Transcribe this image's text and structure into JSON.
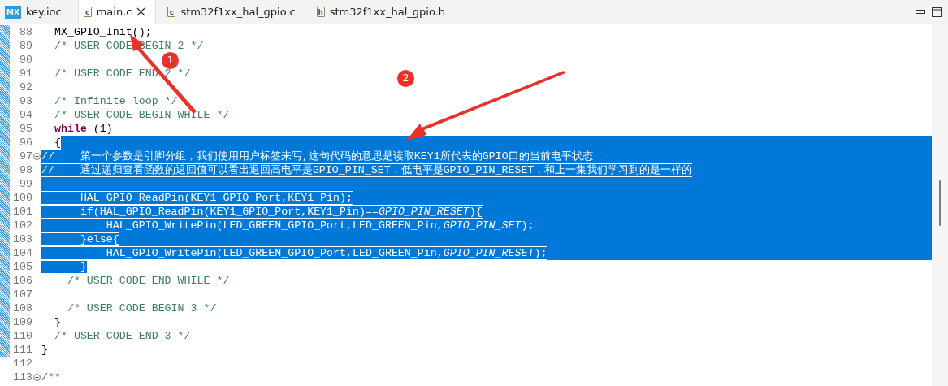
{
  "tabs": [
    {
      "label": "key.ioc",
      "kind": "mx",
      "icon_text": "MX",
      "selected": false
    },
    {
      "label": "main.c",
      "kind": "file",
      "icon_text": "c",
      "selected": true
    },
    {
      "label": "stm32f1xx_hal_gpio.c",
      "kind": "file",
      "icon_text": "c",
      "selected": false
    },
    {
      "label": "stm32f1xx_hal_gpio.h",
      "kind": "file",
      "icon_text": "h",
      "selected": false
    }
  ],
  "lines": [
    {
      "number": "88",
      "marked": true,
      "fold": false,
      "selected": false,
      "segments": [
        {
          "kind": "code",
          "text": "  MX_GPIO_Init();",
          "selected": false
        }
      ]
    },
    {
      "number": "89",
      "marked": true,
      "fold": false,
      "selected": false,
      "segments": [
        {
          "kind": "comment",
          "text": "  /* USER CODE BEGIN 2 */",
          "selected": false
        }
      ]
    },
    {
      "number": "90",
      "marked": true,
      "fold": false,
      "selected": false
    },
    {
      "number": "91",
      "marked": true,
      "fold": false,
      "selected": false,
      "segments": [
        {
          "kind": "comment",
          "text": "  /* USER CODE END 2 */",
          "selected": false
        }
      ]
    },
    {
      "number": "92",
      "marked": true,
      "fold": false,
      "selected": false
    },
    {
      "number": "93",
      "marked": true,
      "fold": false,
      "selected": false,
      "segments": [
        {
          "kind": "comment",
          "text": "  /* Infinite loop */",
          "selected": false
        }
      ]
    },
    {
      "number": "94",
      "marked": true,
      "fold": false,
      "selected": false,
      "segments": [
        {
          "kind": "comment",
          "text": "  /* USER CODE BEGIN WHILE */",
          "selected": false
        }
      ]
    },
    {
      "number": "95",
      "marked": true,
      "fold": false,
      "selected": false,
      "segments": [
        {
          "kind": "keyword",
          "text": "  while",
          "selected": false
        },
        {
          "kind": "code",
          "text": " (1)",
          "selected": false
        }
      ]
    },
    {
      "number": "96",
      "marked": true,
      "fold": false,
      "selected": true,
      "segments": [
        {
          "kind": "code",
          "text": "  {",
          "selected": false
        }
      ]
    },
    {
      "number": "97",
      "marked": true,
      "fold": true,
      "selected": true,
      "segments": [
        {
          "kind": "comment",
          "text": "//    第一个参数是引脚分组，我们使用用户标签来写,这句代码的意思是读取KEY1所代表的GPIO口的当前电平状态",
          "selected": true
        }
      ]
    },
    {
      "number": "98",
      "marked": true,
      "fold": false,
      "selected": true,
      "segments": [
        {
          "kind": "comment",
          "text": "//    通过递归查看函数的返回值可以看出返回高电平是GPIO_PIN_SET，低电平是GPIO_PIN_RESET，和上一集我们学习到的是一样的",
          "selected": true
        }
      ]
    },
    {
      "number": "99",
      "marked": true,
      "fold": false,
      "selected": true
    },
    {
      "number": "100",
      "marked": true,
      "fold": false,
      "selected": true,
      "segments": [
        {
          "kind": "code",
          "text": "      HAL_GPIO_ReadPin(KEY1_GPIO_Port,KEY1_Pin);",
          "selected": true
        }
      ]
    },
    {
      "number": "101",
      "marked": true,
      "fold": false,
      "selected": true,
      "segments": [
        {
          "kind": "code",
          "text": "      if(HAL_GPIO_ReadPin(KEY1_GPIO_Port,KEY1_Pin)==",
          "selected": true
        },
        {
          "kind": "constant",
          "text": "GPIO_PIN_RESET",
          "selected": true
        },
        {
          "kind": "code",
          "text": "){",
          "selected": true
        }
      ]
    },
    {
      "number": "102",
      "marked": true,
      "fold": false,
      "selected": true,
      "segments": [
        {
          "kind": "code",
          "text": "          HAL_GPIO_WritePin(LED_GREEN_GPIO_Port,LED_GREEN_Pin,",
          "selected": true
        },
        {
          "kind": "constant",
          "text": "GPIO_PIN_SET",
          "selected": true
        },
        {
          "kind": "code",
          "text": ");",
          "selected": true
        }
      ]
    },
    {
      "number": "103",
      "marked": true,
      "fold": false,
      "selected": true,
      "segments": [
        {
          "kind": "code",
          "text": "      }else{",
          "selected": true
        }
      ]
    },
    {
      "number": "104",
      "marked": true,
      "fold": false,
      "selected": true,
      "segments": [
        {
          "kind": "code",
          "text": "          HAL_GPIO_WritePin(LED_GREEN_GPIO_Port,LED_GREEN_Pin,",
          "selected": true
        },
        {
          "kind": "constant",
          "text": "GPIO_PIN_RESET",
          "selected": true
        },
        {
          "kind": "code",
          "text": ");",
          "selected": true
        }
      ]
    },
    {
      "number": "105",
      "marked": true,
      "fold": false,
      "selected": false,
      "segments": [
        {
          "kind": "code",
          "text": "      }",
          "selected": true
        }
      ]
    },
    {
      "number": "106",
      "marked": true,
      "fold": false,
      "selected": false,
      "segments": [
        {
          "kind": "comment",
          "text": "    /* USER CODE END WHILE */",
          "selected": false
        }
      ]
    },
    {
      "number": "107",
      "marked": true,
      "fold": false,
      "selected": false
    },
    {
      "number": "108",
      "marked": true,
      "fold": false,
      "selected": false,
      "segments": [
        {
          "kind": "comment",
          "text": "    /* USER CODE BEGIN 3 */",
          "selected": false
        }
      ]
    },
    {
      "number": "109",
      "marked": true,
      "fold": false,
      "selected": false,
      "segments": [
        {
          "kind": "code",
          "text": "  }",
          "selected": false
        }
      ]
    },
    {
      "number": "110",
      "marked": true,
      "fold": false,
      "selected": false,
      "segments": [
        {
          "kind": "comment",
          "text": "  /* USER CODE END 3 */",
          "selected": false
        }
      ]
    },
    {
      "number": "111",
      "marked": true,
      "fold": false,
      "selected": false,
      "segments": [
        {
          "kind": "code",
          "text": "}",
          "selected": false
        }
      ]
    },
    {
      "number": "112",
      "marked": false,
      "fold": false,
      "selected": false
    },
    {
      "number": "113",
      "marked": false,
      "fold": true,
      "selected": false,
      "segments": [
        {
          "kind": "comment",
          "text": "/**",
          "selected": false
        }
      ]
    }
  ],
  "annotations": [
    {
      "label": "1"
    },
    {
      "label": "2"
    }
  ]
}
